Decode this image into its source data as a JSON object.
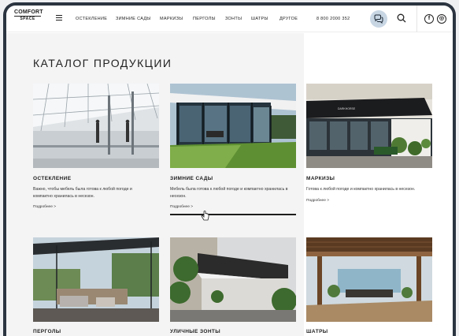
{
  "logo": {
    "line1": "COMFORT",
    "line2": "SPACE"
  },
  "nav": [
    "ОСТЕКЛЕНИЕ",
    "ЗИМНИЕ САДЫ",
    "МАРКИЗЫ",
    "ПЕРГОЛЫ",
    "ЗОНТЫ",
    "ШАТРЫ",
    "ДРУГОЕ"
  ],
  "phone": "8 800 2000 352",
  "icons": {
    "menu": "hamburger-icon",
    "chat": "chat-bubbles-icon",
    "search": "search-icon",
    "facebook": "facebook-icon",
    "instagram": "instagram-icon"
  },
  "social": {
    "facebook": "f",
    "instagram": "◎"
  },
  "page_title": "КАТАЛОГ ПРОДУКЦИИ",
  "products": [
    {
      "name": "ОСТЕКЛЕНИЕ",
      "desc": "Важно, чтобы мебель была готова к любой погоде и компактно хранилась в несезон.",
      "more": "Подробнее >"
    },
    {
      "name": "ЗИМНИЕ САДЫ",
      "desc": "Мебель была готова к любой погоде и компактно хранилась в несезон.",
      "more": "Подробнее >"
    },
    {
      "name": "МАРКИЗЫ",
      "desc": "Готова к любой погоде и компактно хранилась в несезон.",
      "more": "Подробнее >"
    },
    {
      "name": "ПЕРГОЛЫ"
    },
    {
      "name": "УЛИЧНЫЕ ЗОНТЫ"
    },
    {
      "name": "ШАТРЫ"
    }
  ],
  "awning_text": "DARKHORSE",
  "colors": {
    "accent": "#c8d6e4",
    "frame": "#2b3440",
    "panel": "#f4f4f5"
  }
}
